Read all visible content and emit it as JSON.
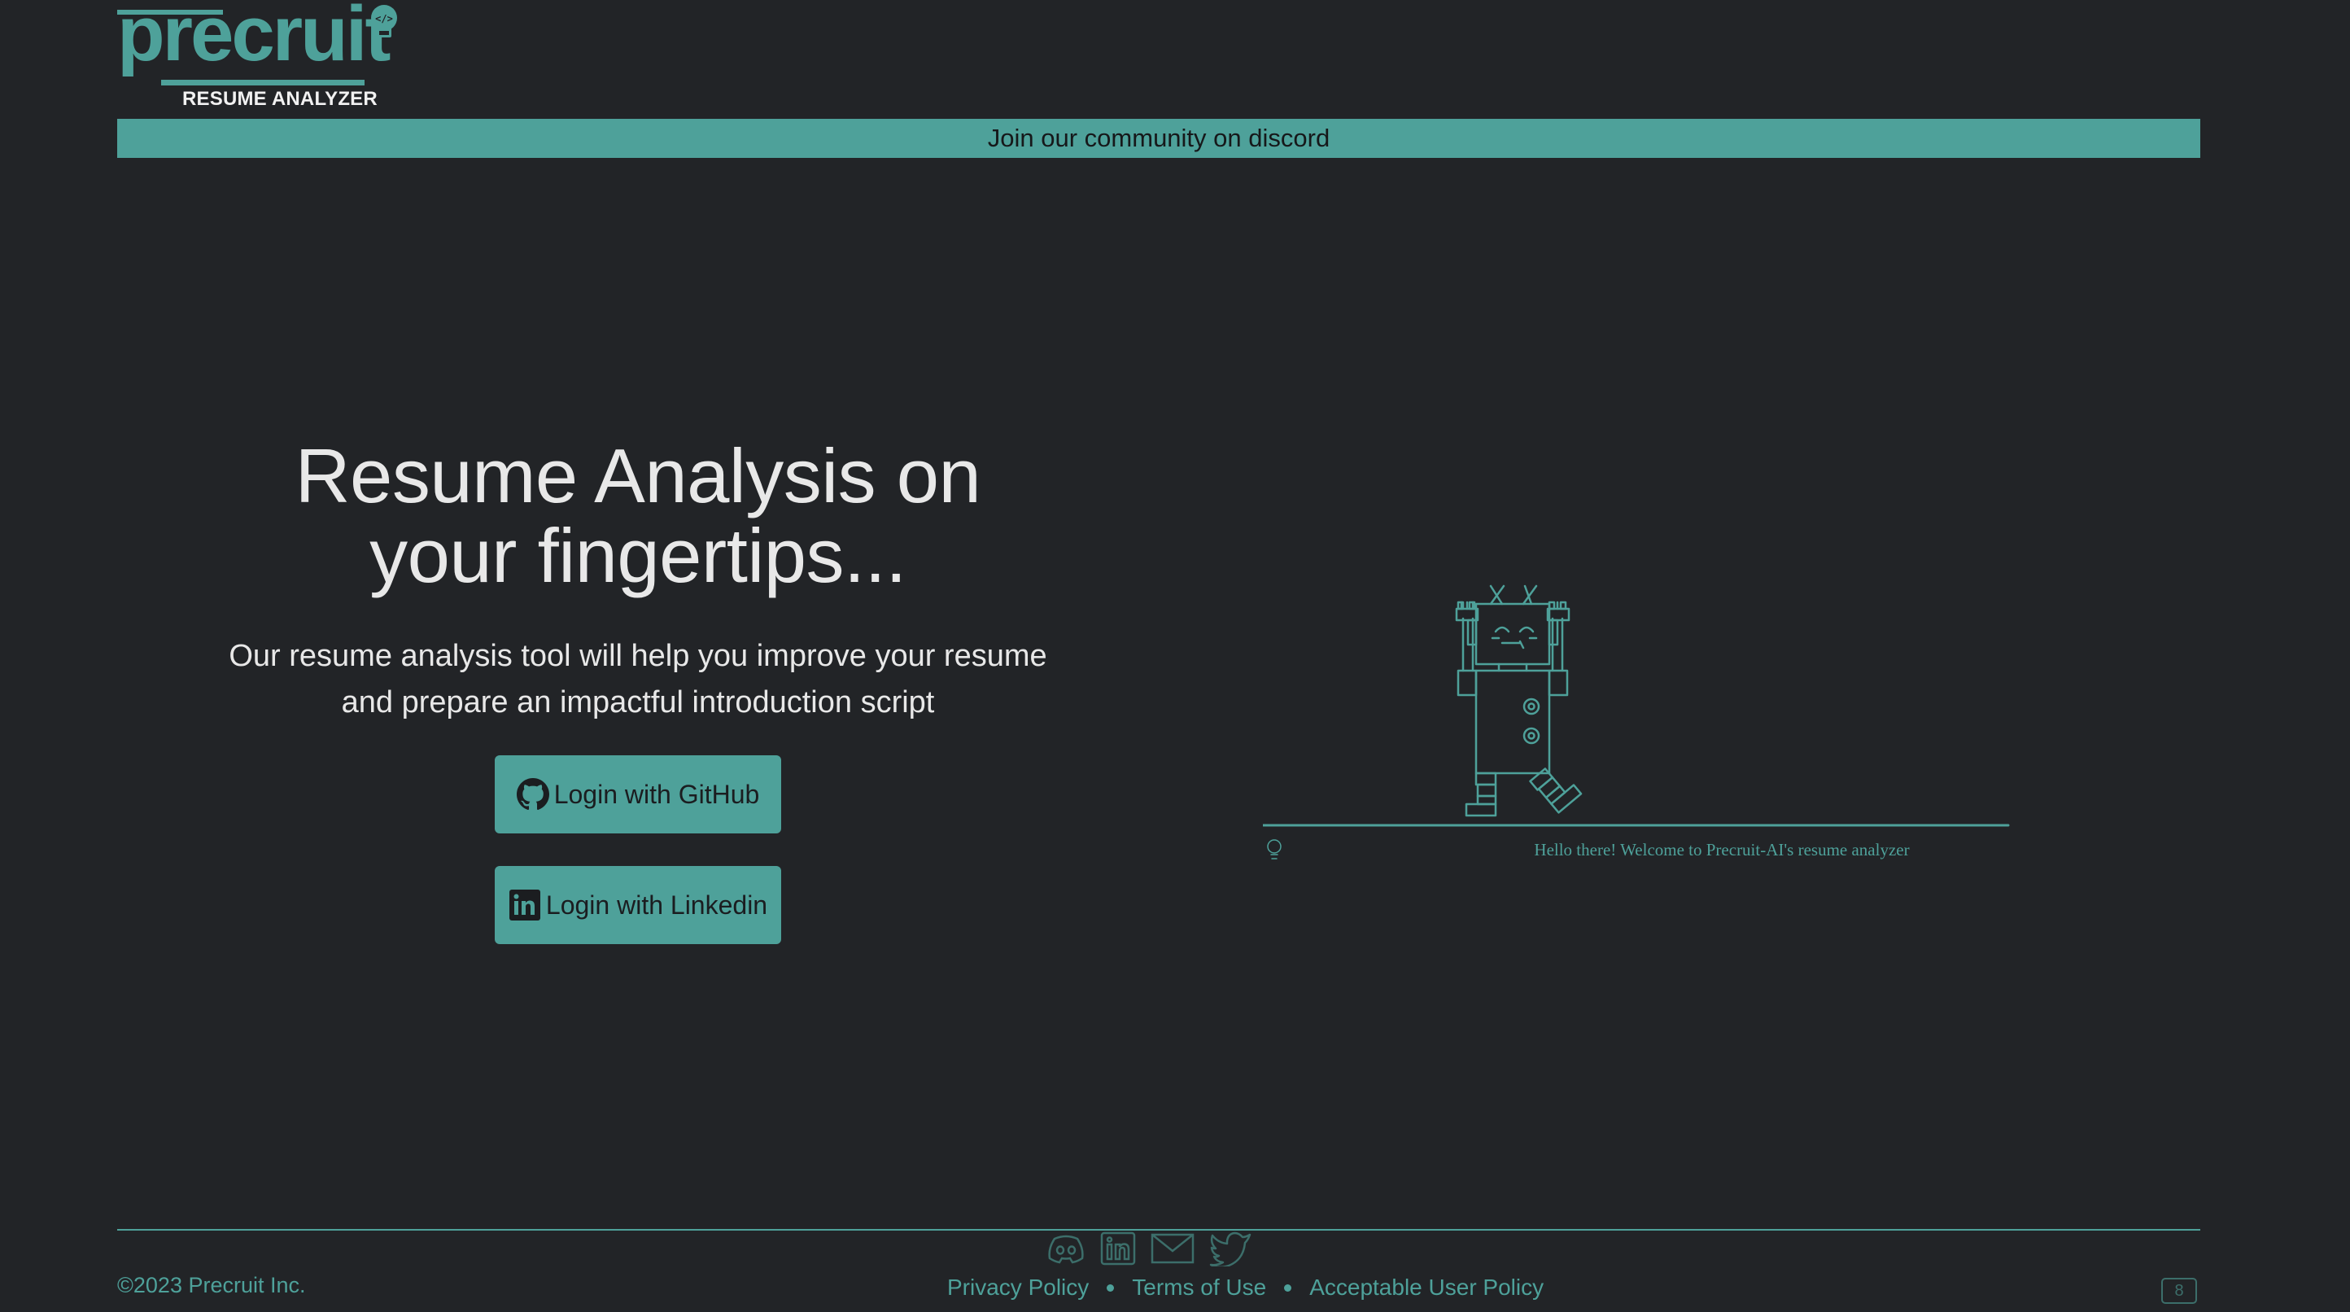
{
  "header": {
    "logo_text": "precruit",
    "logo_subtitle": "RESUME ANALYZER",
    "logo_badge_glyph": "</>"
  },
  "banner": {
    "text": "Join our community on discord"
  },
  "hero": {
    "title_line1": "Resume Analysis on",
    "title_line2": "your fingertips...",
    "subtitle_line1": "Our resume analysis tool will help you improve your resume",
    "subtitle_line2": "and prepare an impactful introduction script",
    "github_button": "Login with GitHub",
    "linkedin_button": "Login with Linkedin"
  },
  "illustration": {
    "caption": "Hello there! Welcome to Precruit-AI's resume analyzer",
    "icon": "robot-icon"
  },
  "footer": {
    "copyright": "©2023 Precruit Inc.",
    "links": [
      "Privacy Policy",
      "Terms of Use",
      "Acceptable User Policy"
    ],
    "social_icons": [
      "discord-icon",
      "linkedin-icon",
      "mail-icon",
      "twitter-icon"
    ],
    "version": "8"
  },
  "colors": {
    "background": "#222427",
    "accent": "#4ea19a",
    "text": "#e8e8e8",
    "button_text": "#1b1d20"
  }
}
